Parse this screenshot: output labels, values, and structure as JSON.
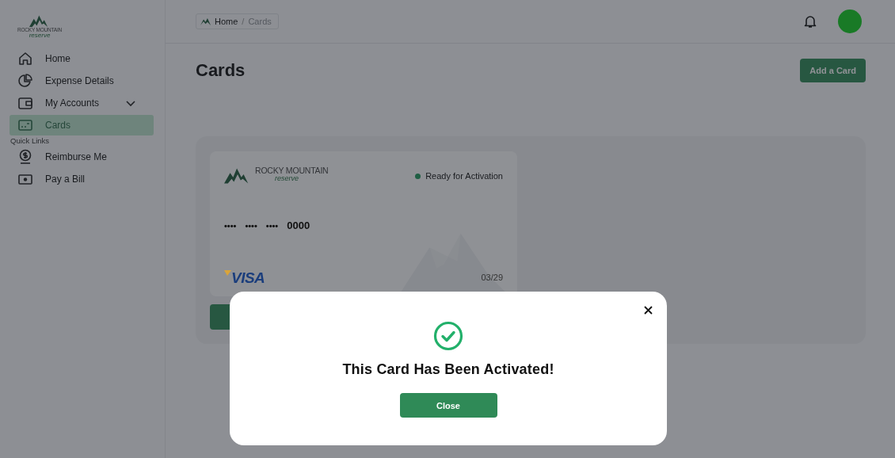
{
  "sidebar": {
    "logo": {
      "name": "ROCKY MOUNTAIN",
      "tagline": "reserve"
    },
    "items": [
      {
        "label": "Home",
        "kind": "link",
        "selected": false
      },
      {
        "label": "Expense Details",
        "kind": "link",
        "selected": false
      },
      {
        "label": "My Accounts",
        "kind": "group",
        "selected": false,
        "expanded": false
      },
      {
        "label": "Cards",
        "kind": "link",
        "selected": true
      }
    ],
    "section_title": "Quick Links",
    "quick_links": [
      {
        "label": "Reimburse Me"
      },
      {
        "label": "Pay a Bill"
      }
    ]
  },
  "header": {
    "breadcrumb": [
      {
        "label": "Home"
      },
      {
        "label": "Cards"
      }
    ],
    "separator": "/"
  },
  "page": {
    "title": "Cards",
    "add_button": "Add a Card"
  },
  "card": {
    "brand": "ROCKY MOUNTAIN",
    "tagline": "reserve",
    "status": "Ready for Activation",
    "number": [
      "••••",
      "••••",
      "••••",
      "0000"
    ],
    "network": "VISA",
    "expiry": "03/29"
  },
  "modal": {
    "title": "This Card Has Been Activated!",
    "button": "Close"
  }
}
